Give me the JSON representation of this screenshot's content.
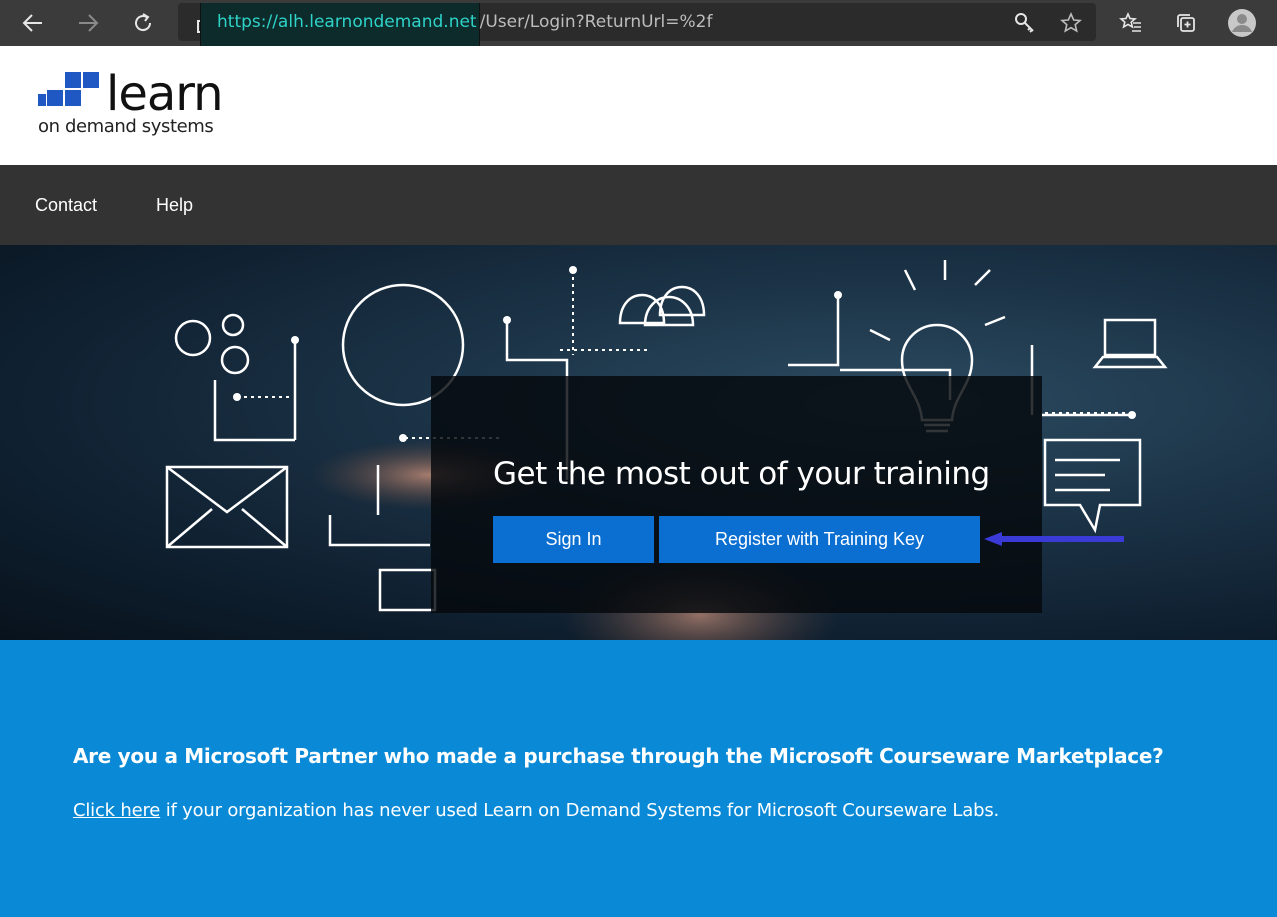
{
  "browser": {
    "url_host": "https://alh.learnondemand.net",
    "url_path": "/User/Login?ReturnUrl=%2f",
    "icons": [
      "back-icon",
      "forward-icon",
      "refresh-icon",
      "lock-icon",
      "key-icon",
      "star-icon",
      "favorites-icon",
      "collections-icon",
      "profile-icon"
    ]
  },
  "header": {
    "logo_word": "learn",
    "logo_sub": "on demand systems"
  },
  "nav": {
    "items": [
      "Contact",
      "Help"
    ]
  },
  "hero": {
    "title": "Get the most out of your training",
    "sign_in": "Sign In",
    "register": "Register with Training Key"
  },
  "promo": {
    "heading": "Are you a Microsoft Partner who made a purchase through the Microsoft Courseware Marketplace?",
    "link_text": "Click here",
    "body_text": " if your organization has never used Learn on Demand Systems for Microsoft Courseware Labs."
  },
  "colors": {
    "accent": "#0b6fd1",
    "promo_bg": "#0a8ad6",
    "nav_bg": "#333333",
    "logo_blue": "#1f57c3",
    "annotation_arrow": "#3a3ad6"
  }
}
